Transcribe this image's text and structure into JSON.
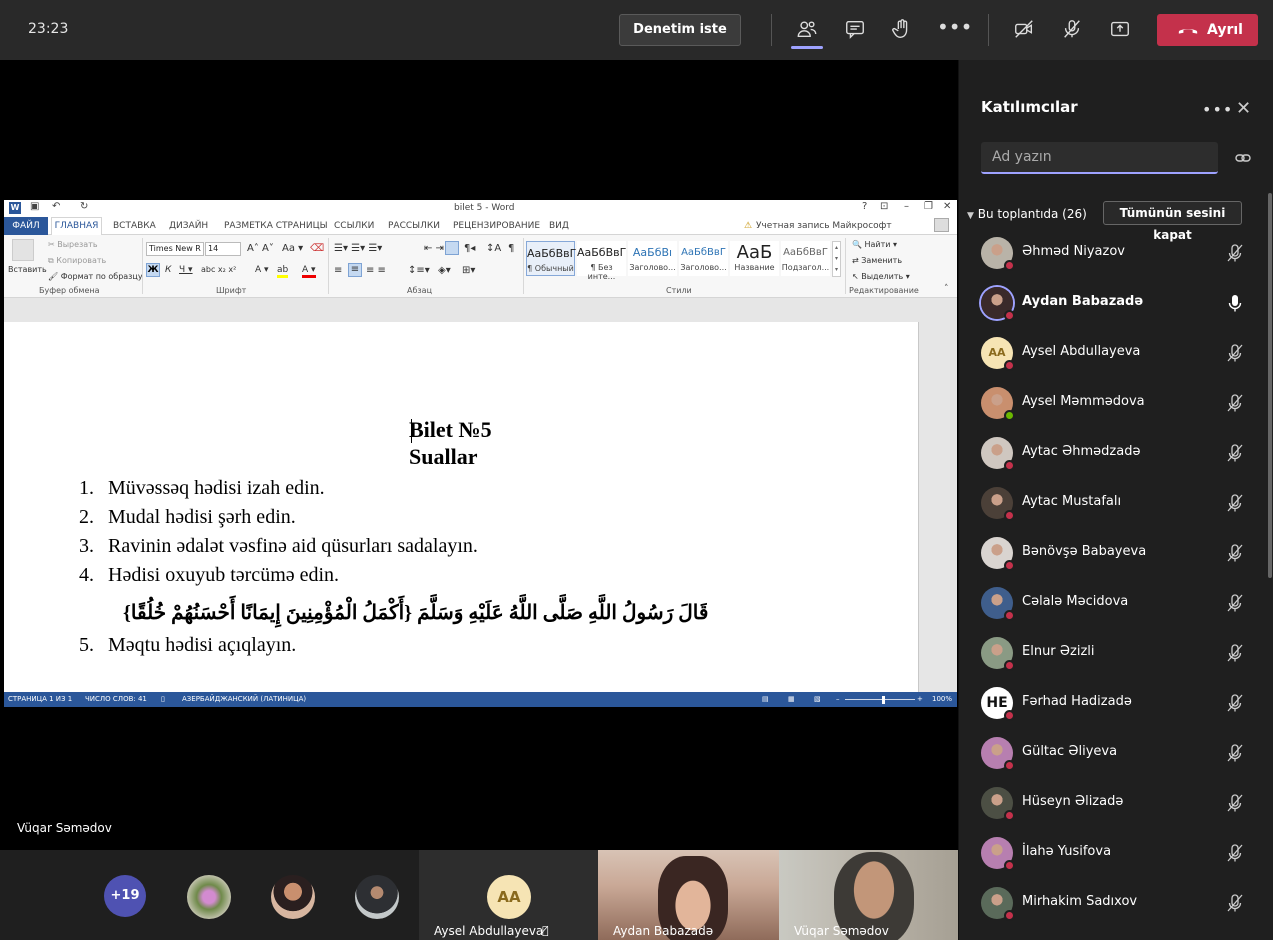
{
  "topbar": {
    "time": "23:23",
    "request_control": "Denetim iste",
    "leave": "Ayrıl",
    "icons": [
      "participants-icon",
      "chat-icon",
      "raise-hand-icon",
      "more-icon",
      "camera-off-icon",
      "mic-off-icon",
      "share-icon",
      "phone-icon"
    ]
  },
  "word": {
    "title": "bilet 5 - Word",
    "account": "Учетная запись Майкрософт",
    "tabs": [
      "ФАЙЛ",
      "ГЛАВНАЯ",
      "ВСТАВКА",
      "ДИЗАЙН",
      "РАЗМЕТКА СТРАНИЦЫ",
      "ССЫЛКИ",
      "РАССЫЛКИ",
      "РЕЦЕНЗИРОВАНИЕ",
      "ВИД"
    ],
    "clipboard": {
      "paste": "Вставить",
      "cut": "Вырезать",
      "copy": "Копировать",
      "format": "Формат по образцу",
      "group": "Буфер обмена"
    },
    "font": {
      "name": "Times New R",
      "size": "14",
      "group": "Шрифт"
    },
    "paragraph_group": "Абзац",
    "styles": [
      {
        "sample": "АаБбВвГ",
        "name": "¶ Обычный"
      },
      {
        "sample": "АаБбВвГ",
        "name": "¶ Без инте..."
      },
      {
        "sample": "АаБбВı",
        "name": "Заголово..."
      },
      {
        "sample": "АаБбВвГ",
        "name": "Заголово..."
      },
      {
        "sample": "АаБ",
        "name": "Название"
      },
      {
        "sample": "АаБбВвГ",
        "name": "Подзагол..."
      }
    ],
    "styles_group": "Стили",
    "editing": {
      "find": "Найти",
      "replace": "Заменить",
      "select": "Выделить",
      "group": "Редактирование"
    },
    "doc": {
      "title": "Bilet №5",
      "subtitle": "Suallar",
      "questions": [
        {
          "n": "1.",
          "text": "Müvəssəq hədisi izah edin."
        },
        {
          "n": "2.",
          "text": "Mudal hədisi şərh edin."
        },
        {
          "n": "3.",
          "text": "Ravinin ədalət vəsfinə aid qüsurları sadalayın."
        },
        {
          "n": "4.",
          "text": "Hədisi oxuyub tərcümə edin."
        },
        {
          "n": "5.",
          "text": "Məqtu hədisi açıqlayın."
        }
      ],
      "arabic": "قَالَ رَسُولُ اللَّهِ صَلَّى اللَّهُ عَلَيْهِ وَسَلَّمَ {أَكْمَلُ الْمُؤْمِنِينَ إِيمَانًا أَحْسَنُهُمْ خُلُقًا}"
    },
    "status": {
      "page": "СТРАНИЦА 1 ИЗ 1",
      "words": "ЧИСЛО СЛОВ: 41",
      "lang": "АЗЕРБАЙДЖАНСКИЙ (ЛАТИНИЦА)",
      "zoom": "100%"
    }
  },
  "stage": {
    "presenter": "Vüqar Səmədov",
    "overflow_count": "+19",
    "tiles": [
      {
        "name": "Aysel Abdullayeva",
        "initials": "AA"
      },
      {
        "name": "Aydan Babazadə"
      },
      {
        "name": "Vüqar Səmədov"
      }
    ]
  },
  "panel": {
    "title": "Katılımcılar",
    "search_placeholder": "Ad yazın",
    "section": "Bu toplantıda (26)",
    "mute_all": "Tümünün sesini kapat",
    "participants": [
      {
        "name": "Əhməd Niyazov",
        "status": "#c4314b",
        "mic": "off",
        "bold": false,
        "bg": "#b9b3a8"
      },
      {
        "name": "Aydan Babazadə",
        "status": "#c4314b",
        "mic": "on",
        "bold": true,
        "bg": "#3a2a2a"
      },
      {
        "name": "Aysel Abdullayeva",
        "status": "#c4314b",
        "mic": "off",
        "bold": false,
        "initials": "AA"
      },
      {
        "name": "Aysel Məmmədova",
        "status": "#6bb700",
        "mic": "off",
        "bold": false,
        "bg": "#c98f6e"
      },
      {
        "name": "Aytac Əhmədzadə",
        "status": "#c4314b",
        "mic": "off",
        "bold": false,
        "bg": "#cfc7c0"
      },
      {
        "name": "Aytac Mustafalı",
        "status": "#c4314b",
        "mic": "off",
        "bold": false,
        "bg": "#4b4038"
      },
      {
        "name": "Bənövşə Babayeva",
        "status": "#c4314b",
        "mic": "off",
        "bold": false,
        "bg": "#d9d4d0"
      },
      {
        "name": "Cəlalə Məcidova",
        "status": "#c4314b",
        "mic": "off",
        "bold": false,
        "bg": "#3f5e8c"
      },
      {
        "name": "Elnur Əzizli",
        "status": "#c4314b",
        "mic": "off",
        "bold": false,
        "bg": "#8a9a84"
      },
      {
        "name": "Fərhad Hadizadə",
        "status": "#c4314b",
        "mic": "off",
        "bold": false,
        "initials": "HE"
      },
      {
        "name": "Gültac Əliyeva",
        "status": "#c4314b",
        "mic": "off",
        "bold": false,
        "bg": "#b77fb0"
      },
      {
        "name": "Hüseyn Əlizadə",
        "status": "#c4314b",
        "mic": "off",
        "bold": false,
        "bg": "#4c4f44"
      },
      {
        "name": "İlahə Yusifova",
        "status": "#c4314b",
        "mic": "off",
        "bold": false,
        "bg": "#b77fb0"
      },
      {
        "name": "Mirhakim Sadıxov",
        "status": "#c4314b",
        "mic": "off",
        "bold": false,
        "bg": "#5a6a5a"
      }
    ]
  }
}
